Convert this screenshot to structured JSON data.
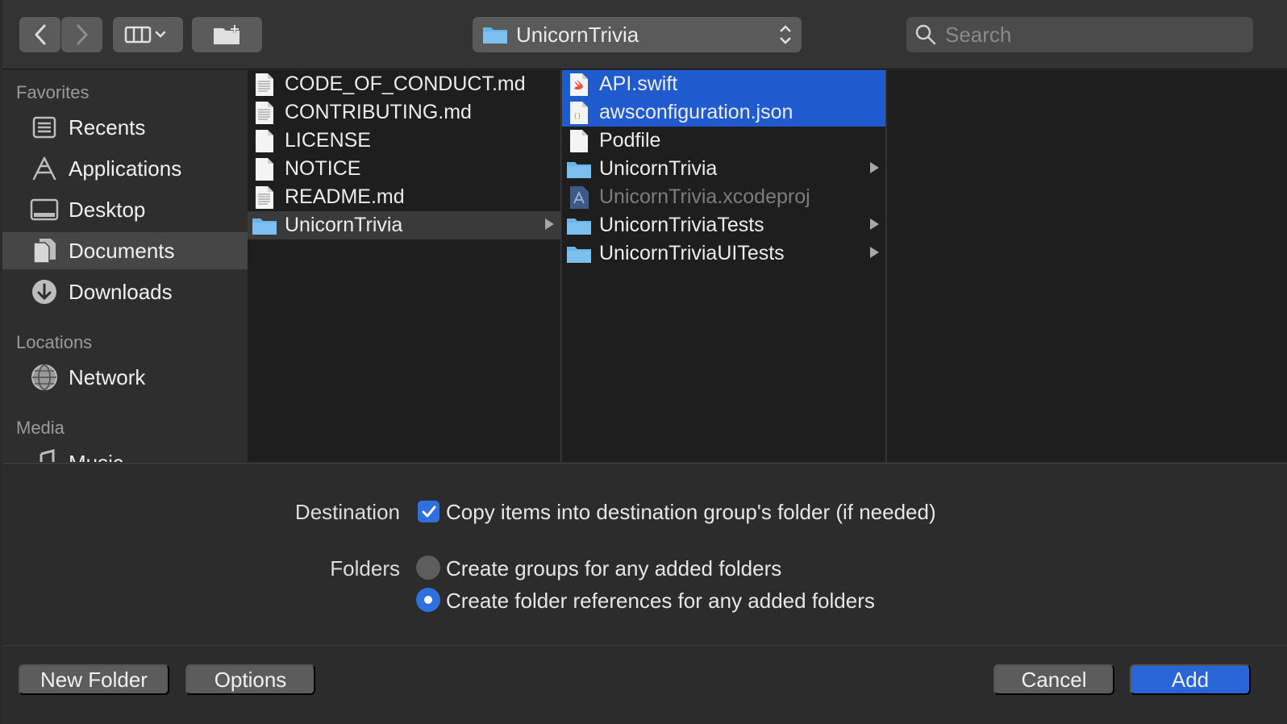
{
  "toolbar": {
    "back_icon": "chevron-left-icon",
    "forward_icon": "chevron-right-icon",
    "view_icon": "column-view-icon",
    "new_folder_icon": "new-folder-icon",
    "path_popup_label": "UnicornTrivia",
    "search_placeholder": "Search"
  },
  "sidebar": {
    "sections": [
      {
        "title": "Favorites",
        "items": [
          {
            "label": "Recents",
            "icon": "recents-icon"
          },
          {
            "label": "Applications",
            "icon": "applications-icon"
          },
          {
            "label": "Desktop",
            "icon": "desktop-icon"
          },
          {
            "label": "Documents",
            "icon": "documents-icon",
            "selected": true
          },
          {
            "label": "Downloads",
            "icon": "downloads-icon"
          }
        ]
      },
      {
        "title": "Locations",
        "items": [
          {
            "label": "Network",
            "icon": "network-icon"
          }
        ]
      },
      {
        "title": "Media",
        "items": [
          {
            "label": "Music",
            "icon": "music-icon"
          }
        ]
      }
    ]
  },
  "columns": {
    "col1": [
      {
        "name": "CODE_OF_CONDUCT.md",
        "icon": "text-file-icon"
      },
      {
        "name": "CONTRIBUTING.md",
        "icon": "text-file-icon"
      },
      {
        "name": "LICENSE",
        "icon": "blank-file-icon"
      },
      {
        "name": "NOTICE",
        "icon": "blank-file-icon"
      },
      {
        "name": "README.md",
        "icon": "text-file-icon"
      },
      {
        "name": "UnicornTrivia",
        "icon": "folder-icon",
        "selected": "gray",
        "has_children": true
      }
    ],
    "col2": [
      {
        "name": "API.swift",
        "icon": "swift-file-icon",
        "selected": "blue"
      },
      {
        "name": "awsconfiguration.json",
        "icon": "json-file-icon",
        "selected": "blue"
      },
      {
        "name": "Podfile",
        "icon": "blank-file-icon"
      },
      {
        "name": "UnicornTrivia",
        "icon": "folder-icon",
        "has_children": true
      },
      {
        "name": "UnicornTrivia.xcodeproj",
        "icon": "xcodeproj-icon",
        "disabled": true
      },
      {
        "name": "UnicornTriviaTests",
        "icon": "folder-icon",
        "has_children": true
      },
      {
        "name": "UnicornTriviaUITests",
        "icon": "folder-icon",
        "has_children": true
      }
    ]
  },
  "options": {
    "destination_label": "Destination",
    "copy_items_text": "Copy items into destination group's folder (if needed)",
    "copy_items_checked": true,
    "folders_label": "Folders",
    "create_groups_text": "Create groups for any added folders",
    "create_refs_text": "Create folder references for any added folders",
    "folders_selected": "create_refs"
  },
  "footer": {
    "new_folder_label": "New Folder",
    "options_label": "Options",
    "cancel_label": "Cancel",
    "add_label": "Add"
  },
  "colors": {
    "accent": "#2a65d8",
    "selection_blue": "#1f5bce",
    "folder_blue": "#6bb3e6"
  }
}
